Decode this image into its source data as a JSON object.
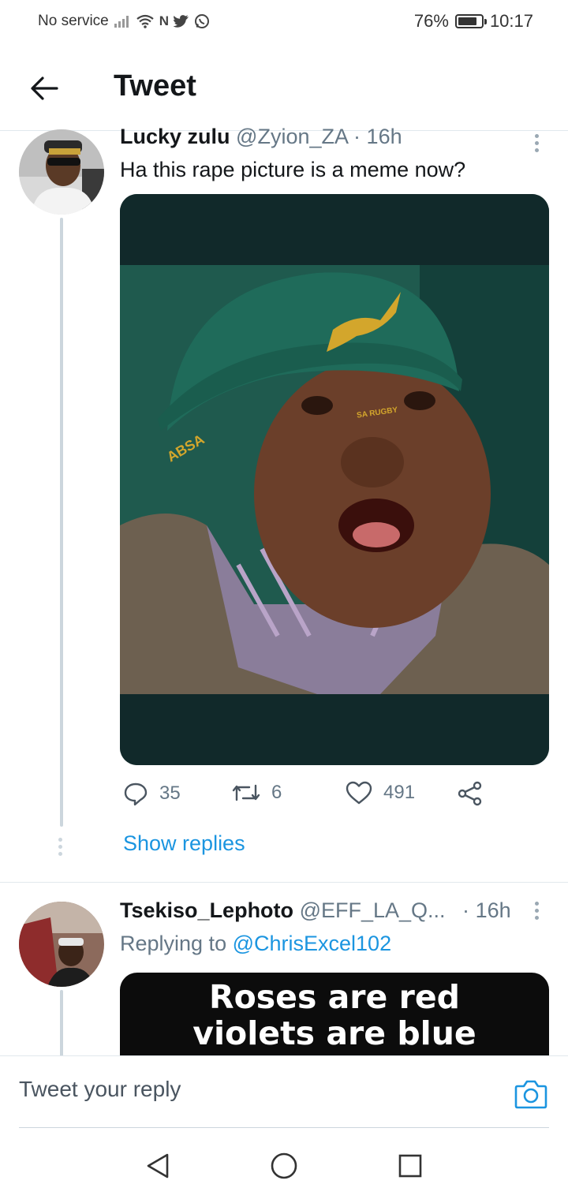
{
  "status_bar": {
    "carrier": "No service",
    "battery": "76%",
    "time": "10:17",
    "icons": [
      "signal-icon",
      "wifi-icon",
      "nfc-icon",
      "twitter-icon",
      "whatsapp-icon"
    ]
  },
  "header": {
    "back_icon": "arrow-left-icon",
    "title": "Tweet"
  },
  "tweets": [
    {
      "name": "Lucky zulu",
      "handle": "@Zyion_ZA",
      "separator": "·",
      "time": "16h",
      "text": "Ha this rape picture is a meme now?",
      "media": {
        "caption_on_cap_brand": "ABSA",
        "caption_on_cap_logo": "SA RUGBY"
      },
      "actions": {
        "replies": "35",
        "retweets": "6",
        "likes": "491"
      },
      "show_replies": "Show replies"
    },
    {
      "name": "Tsekiso_Lephoto",
      "handle": "@EFF_LA_Q...",
      "separator": "·",
      "time": "16h",
      "replying_prefix": "Replying to",
      "replying_to": "@ChrisExcel102",
      "media": {
        "line1": "Roses are red",
        "line2": "violets are blue"
      }
    }
  ],
  "composer": {
    "placeholder": "Tweet your reply",
    "camera_icon": "camera-icon"
  },
  "navbar": {
    "icons": [
      "back-triangle-icon",
      "home-circle-icon",
      "recents-square-icon"
    ]
  },
  "colors": {
    "accent": "#1b95e0",
    "text": "#14171a",
    "secondary": "#657786",
    "divider": "#e1e8ed"
  }
}
